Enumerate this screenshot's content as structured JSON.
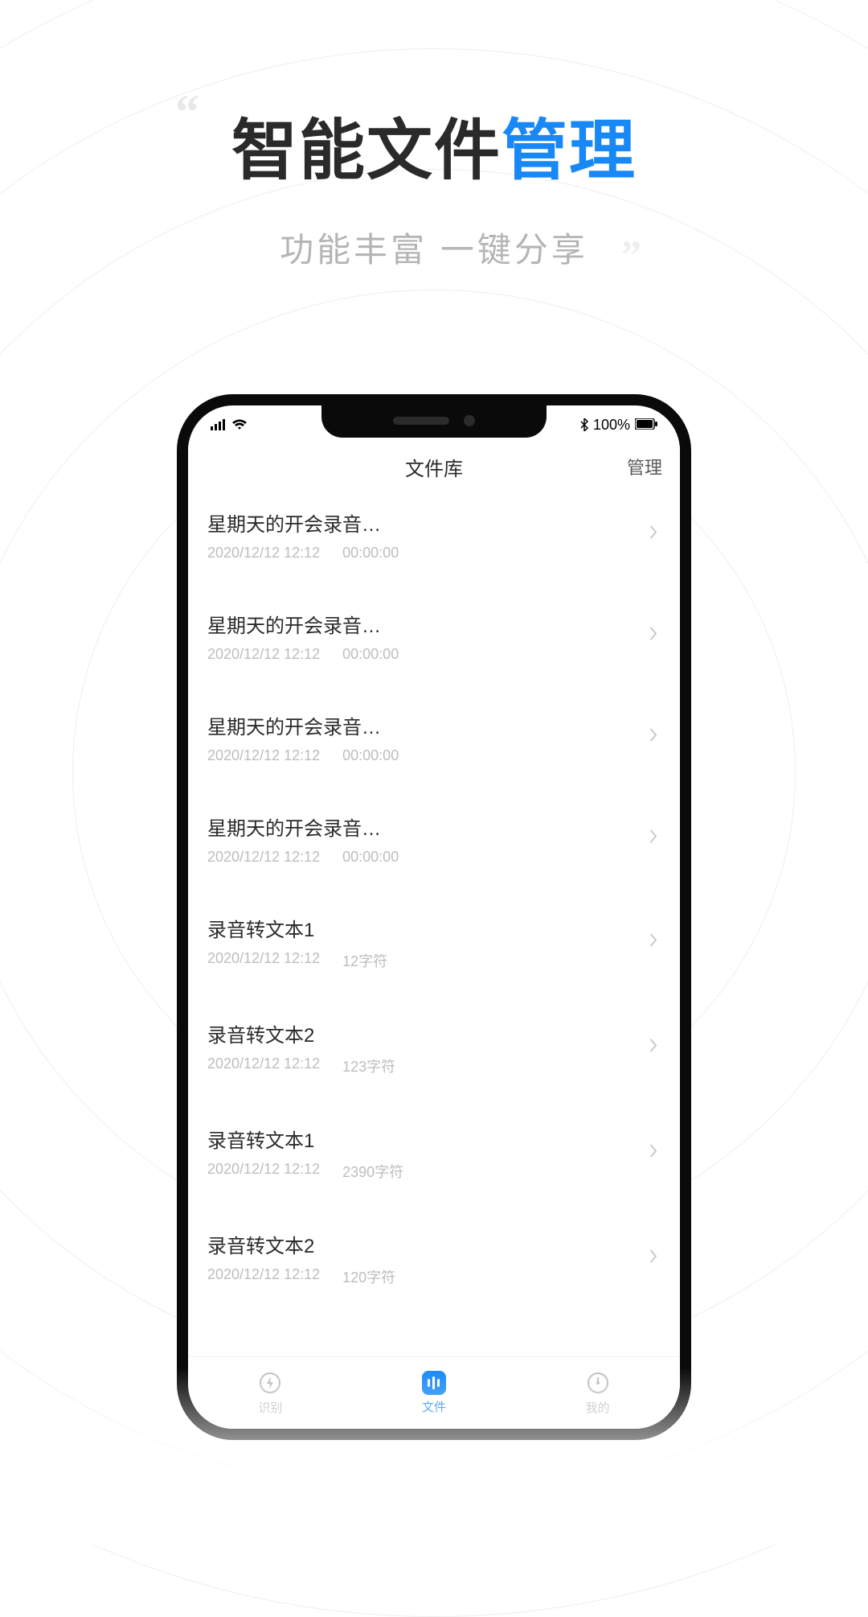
{
  "hero": {
    "title_part1": "智能文件",
    "title_accent": "管理",
    "subtitle": "功能丰富 一键分享"
  },
  "status": {
    "battery_text": "100%",
    "bluetooth": "bluetooth-icon"
  },
  "nav": {
    "title": "文件库",
    "manage": "管理"
  },
  "files": [
    {
      "title": "星期天的开会录音…",
      "date": "2020/12/12 12:12",
      "meta": "00:00:00"
    },
    {
      "title": "星期天的开会录音…",
      "date": "2020/12/12 12:12",
      "meta": "00:00:00"
    },
    {
      "title": "星期天的开会录音…",
      "date": "2020/12/12 12:12",
      "meta": "00:00:00"
    },
    {
      "title": "星期天的开会录音…",
      "date": "2020/12/12 12:12",
      "meta": "00:00:00"
    },
    {
      "title": "录音转文本1",
      "date": "2020/12/12 12:12",
      "meta": "12字符"
    },
    {
      "title": "录音转文本2",
      "date": "2020/12/12 12:12",
      "meta": "123字符"
    },
    {
      "title": "录音转文本1",
      "date": "2020/12/12 12:12",
      "meta": "2390字符"
    },
    {
      "title": "录音转文本2",
      "date": "2020/12/12 12:12",
      "meta": "120字符"
    }
  ],
  "tabs": {
    "recognize": "识别",
    "files": "文件",
    "mine": "我的"
  },
  "colors": {
    "accent": "#1888f7",
    "text": "#2a2a2a",
    "muted": "#bdbdbd"
  }
}
